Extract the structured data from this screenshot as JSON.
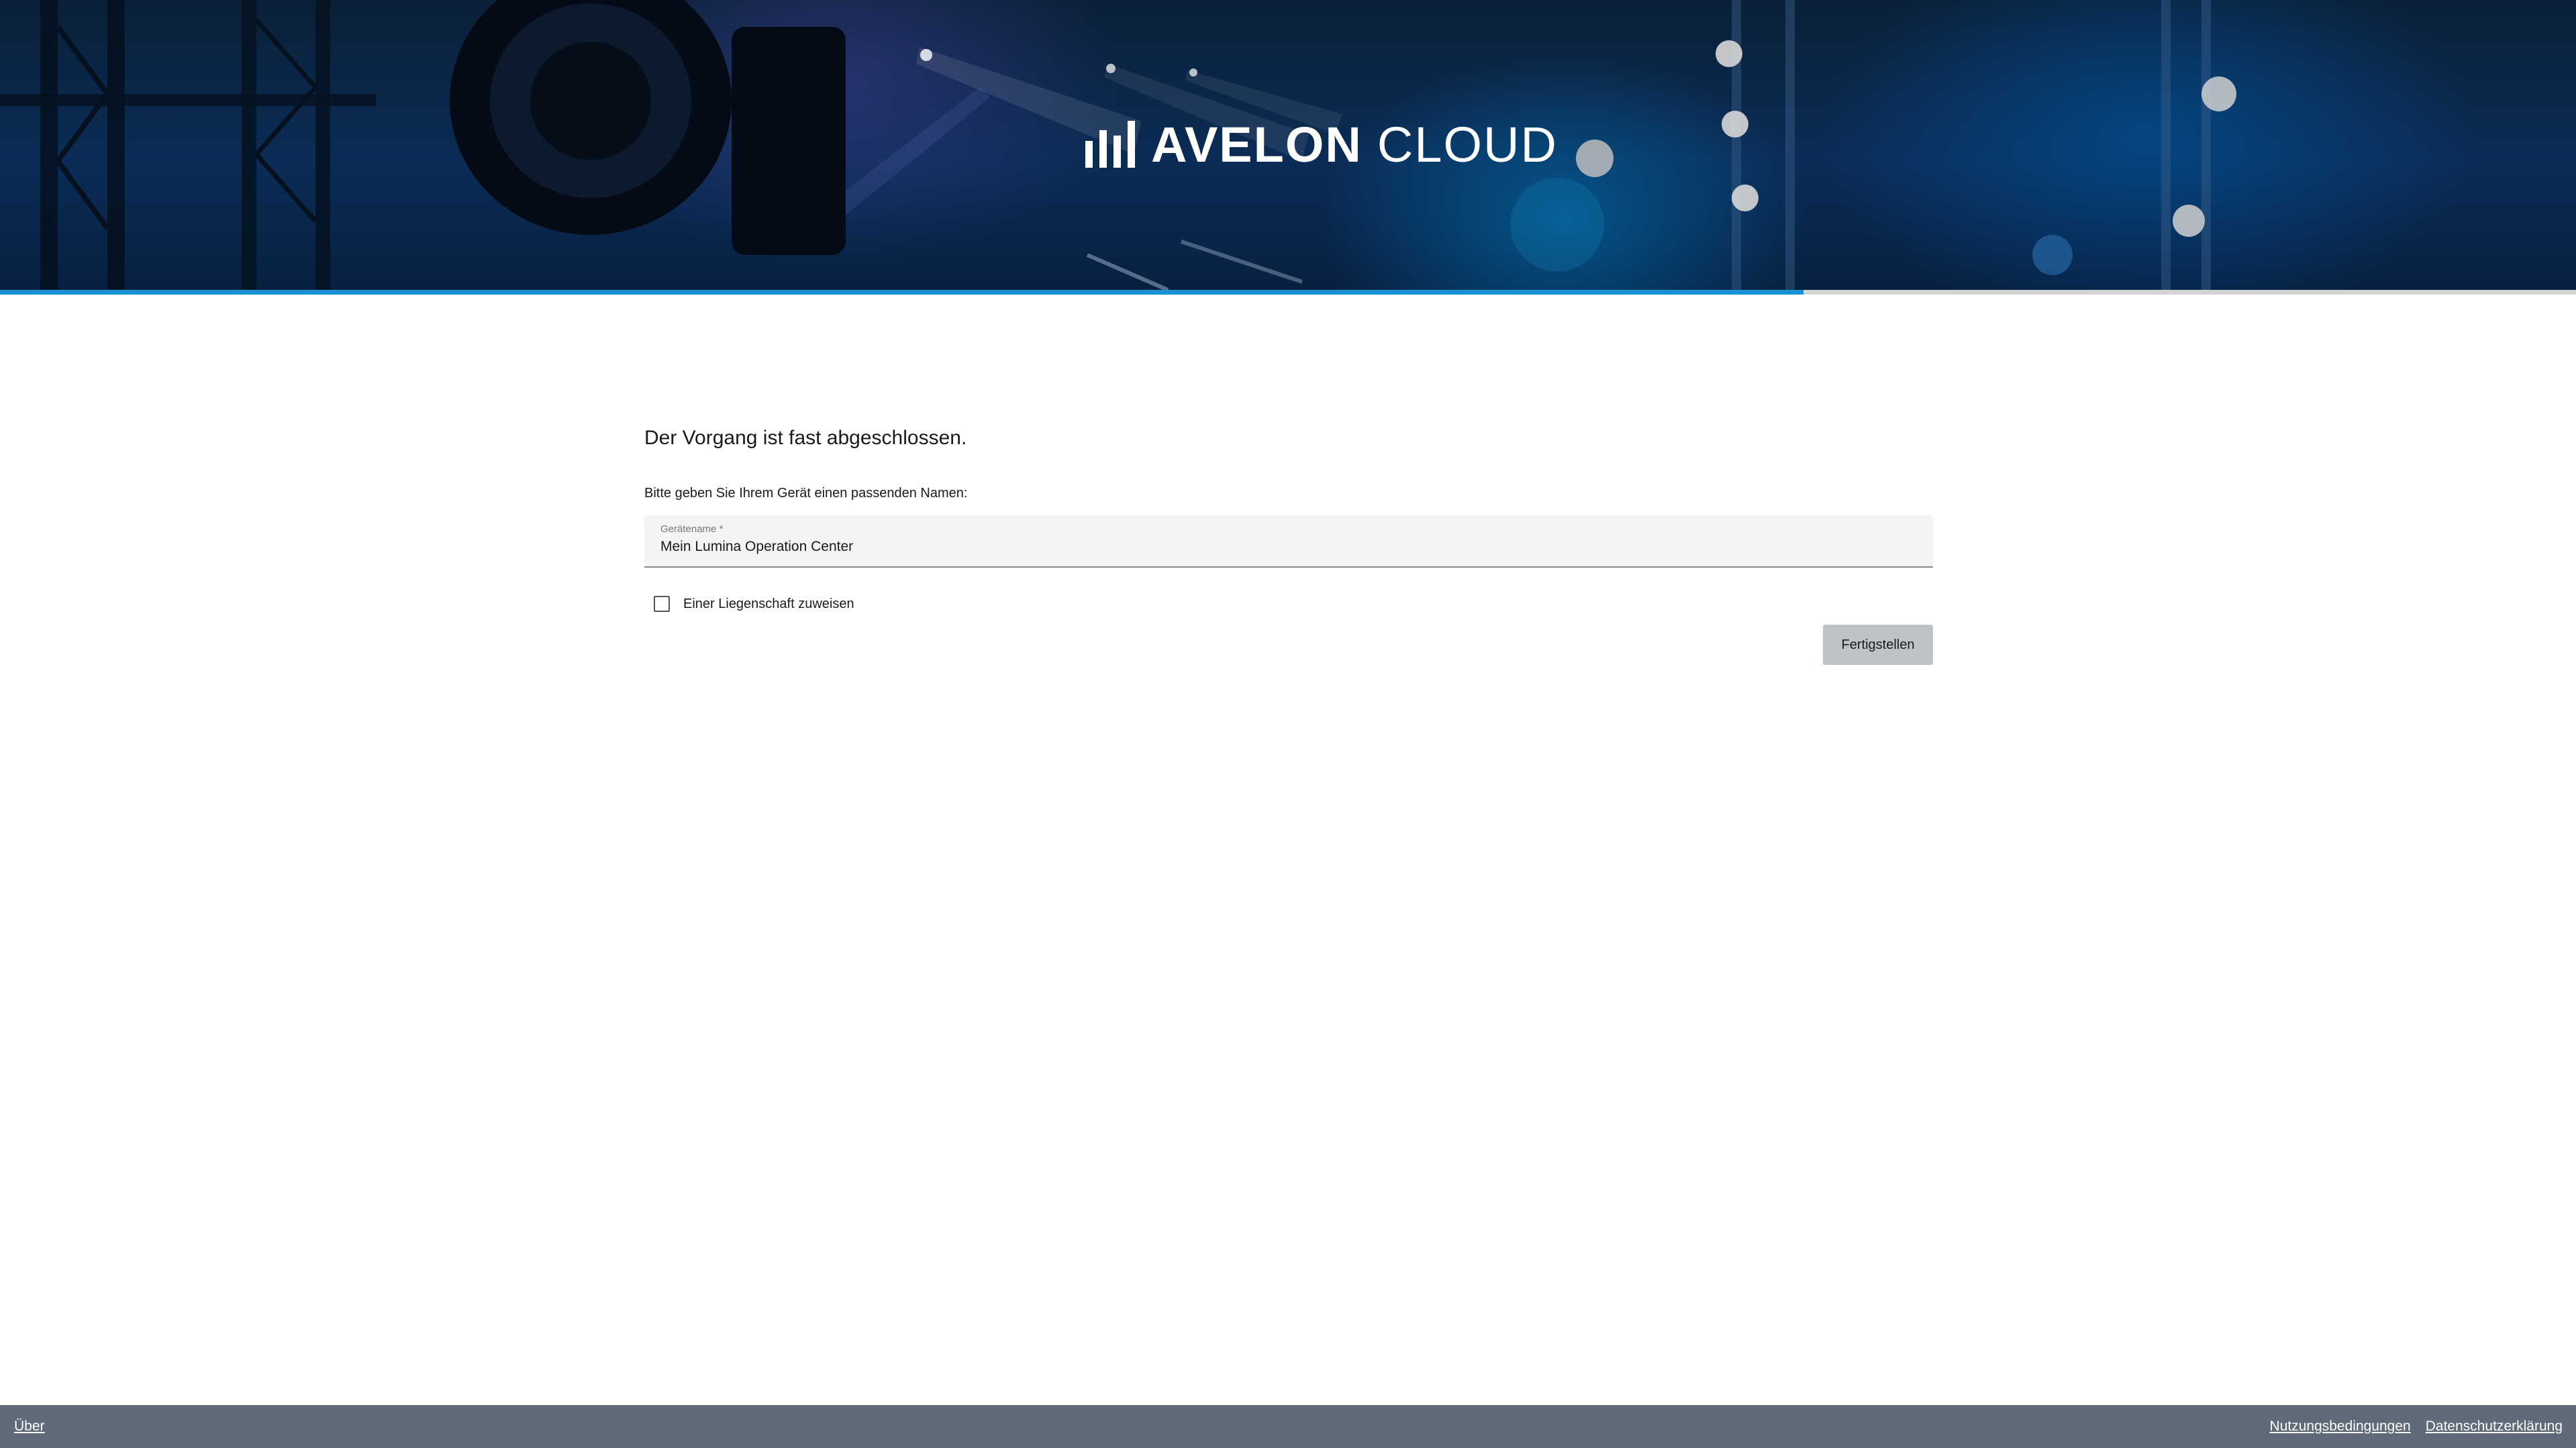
{
  "brand": {
    "name_strong": "AVELON",
    "name_light": "CLOUD",
    "logo_icon": "bar-chart-logo-icon"
  },
  "progress": {
    "fraction": 0.7
  },
  "form": {
    "heading": "Der Vorgang ist fast abgeschlossen.",
    "instruction": "Bitte geben Sie Ihrem Gerät einen passenden Namen:",
    "device_name_label": "Gerätename *",
    "device_name_value": "Mein Lumina Operation Center",
    "assign_property_label": "Einer Liegenschaft zuweisen",
    "assign_property_checked": false,
    "finish_label": "Fertigstellen"
  },
  "footer": {
    "about": "Über",
    "terms": "Nutzungsbedingungen",
    "privacy": "Datenschutzerklärung"
  },
  "colors": {
    "progress_accent": "#1a90d4",
    "footer_bg": "#5f6b78",
    "button_bg": "#bfc2c6"
  }
}
